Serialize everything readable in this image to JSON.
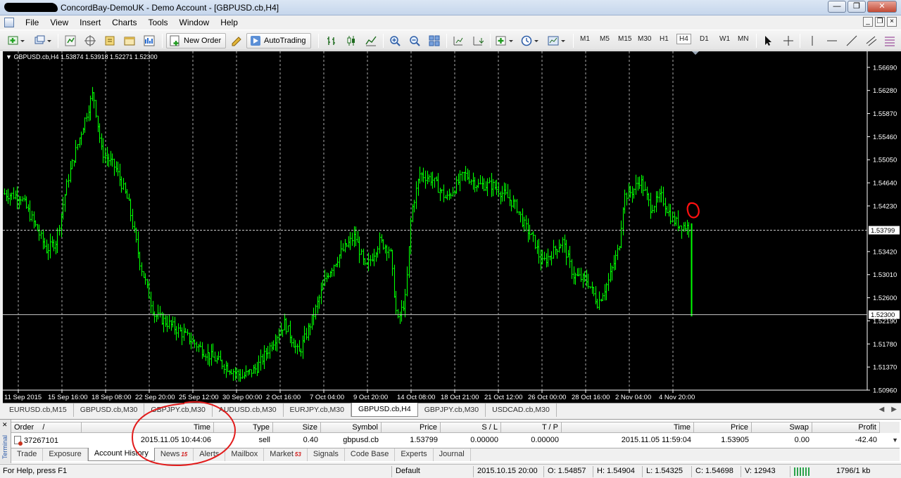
{
  "window": {
    "title": "ConcordBay-DemoUK - Demo Account - [GBPUSD.cb,H4]"
  },
  "menu": [
    "File",
    "View",
    "Insert",
    "Charts",
    "Tools",
    "Window",
    "Help"
  ],
  "toolbar": {
    "new_order": "New Order",
    "autotrading": "AutoTrading",
    "timeframes": [
      "M1",
      "M5",
      "M15",
      "M30",
      "H1",
      "H4",
      "D1",
      "W1",
      "MN"
    ],
    "active_timeframe": "H4"
  },
  "chart": {
    "info": "GBPUSD.cb,H4  1.53874 1.53918 1.52271 1.52300",
    "price_labels": [
      "1.56690",
      "1.56280",
      "1.55870",
      "1.55460",
      "1.55050",
      "1.54640",
      "1.54230",
      "1.53799",
      "1.53420",
      "1.53010",
      "1.52600",
      "1.52300",
      "1.52190",
      "1.51780",
      "1.51370",
      "1.50960"
    ],
    "time_labels": [
      "11 Sep 2015",
      "15 Sep 16:00",
      "18 Sep 08:00",
      "22 Sep 20:00",
      "25 Sep 12:00",
      "30 Sep 00:00",
      "2 Oct 16:00",
      "7 Oct 04:00",
      "9 Oct 20:00",
      "14 Oct 08:00",
      "18 Oct 21:00",
      "21 Oct 12:00",
      "26 Oct 00:00",
      "28 Oct 16:00",
      "2 Nov 04:00",
      "4 Nov 20:00"
    ],
    "bid_line": "1.53799",
    "last_line": "1.52300",
    "colors": {
      "background": "#000000",
      "bars": "#00ff00",
      "grid": "#c8c8c8",
      "annotation": "#ff0000"
    }
  },
  "chart_tabs": [
    "EURUSD.cb,M15",
    "GBPUSD.cb,M30",
    "GBPJPY.cb,M30",
    "AUDUSD.cb,M30",
    "EURJPY.cb,M30",
    "GBPUSD.cb,H4",
    "GBPJPY.cb,M30",
    "USDCAD.cb,M30"
  ],
  "active_chart_tab": "GBPUSD.cb,H4",
  "terminal": {
    "side_label": "Terminal",
    "columns": [
      "Order",
      "/",
      "Time",
      "Type",
      "Size",
      "Symbol",
      "Price",
      "S / L",
      "T / P",
      "Time",
      "Price",
      "Swap",
      "Profit"
    ],
    "rows": [
      {
        "order": "37267101",
        "open_time": "2015.11.05 10:44:06",
        "type": "sell",
        "size": "0.40",
        "symbol": "gbpusd.cb",
        "price": "1.53799",
        "sl": "0.00000",
        "tp": "0.00000",
        "close_time": "2015.11.05 11:59:04",
        "close_price": "1.53905",
        "swap": "0.00",
        "profit": "-42.40"
      }
    ],
    "tabs": [
      "Trade",
      "Exposure",
      "Account History",
      "News",
      "Alerts",
      "Mailbox",
      "Market",
      "Signals",
      "Code Base",
      "Experts",
      "Journal"
    ],
    "active_tab": "Account History",
    "news_badge": "15",
    "market_badge": "53"
  },
  "status": {
    "help": "For Help, press F1",
    "profile": "Default",
    "datetime": "2015.10.15 20:00",
    "open": "O: 1.54857",
    "high": "H: 1.54904",
    "low": "L: 1.54325",
    "close": "C: 1.54698",
    "volume": "V: 12943",
    "traffic": "1796/1 kb"
  }
}
